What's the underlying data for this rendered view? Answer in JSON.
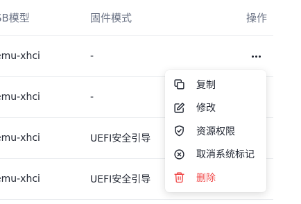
{
  "table": {
    "headers": {
      "model": "SB模型",
      "firmware": "固件模式",
      "actions": "操作"
    },
    "rows": [
      {
        "model": "emu-xhci",
        "firmware": "-"
      },
      {
        "model": "emu-xhci",
        "firmware": "-"
      },
      {
        "model": "emu-xhci",
        "firmware": "UEFI安全引导"
      },
      {
        "model": "emu-xhci",
        "firmware": "UEFI安全引导"
      }
    ]
  },
  "menu": {
    "items": [
      {
        "label": "复制",
        "icon": "copy-icon"
      },
      {
        "label": "修改",
        "icon": "edit-icon"
      },
      {
        "label": "资源权限",
        "icon": "shield-icon"
      },
      {
        "label": "取消系统标记",
        "icon": "close-circle-icon"
      },
      {
        "label": "删除",
        "icon": "trash-icon"
      }
    ],
    "danger_color": "#f04b4b"
  }
}
